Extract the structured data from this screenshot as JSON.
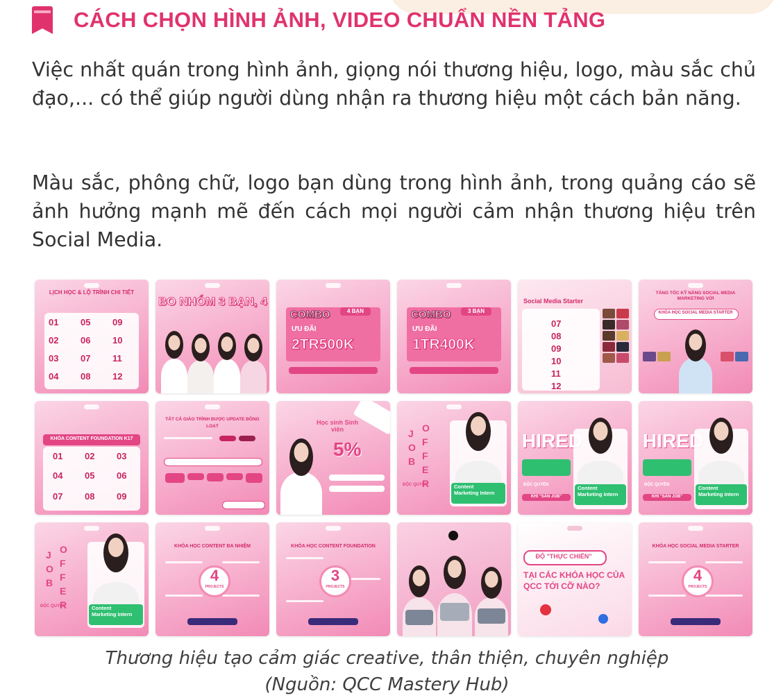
{
  "heading": {
    "title": "CÁCH CHỌN HÌNH ẢNH, VIDEO CHUẨN NỀN TẢNG",
    "icon": "bookmark-icon",
    "color": "#e0336e"
  },
  "paragraphs": [
    "Việc nhất quán trong hình ảnh, giọng nói thương hiệu, logo, màu sắc chủ đạo,... có thể giúp người dùng nhận ra thương hiệu một cách bản năng.",
    "Màu sắc, phông chữ, logo bạn dùng trong hình ảnh, trong quảng cáo sẽ ảnh hưởng mạnh mẽ đến cách mọi người cảm nhận thương hiệu trên Social Media."
  ],
  "gallery": {
    "accent_color": "#e34684",
    "tiles": [
      {
        "heading": "LỊCH HỌC & LỘ TRÌNH CHI TIẾT",
        "numbers": [
          "01",
          "05",
          "09",
          "02",
          "06",
          "10",
          "03",
          "07",
          "11",
          "04",
          "08",
          "12"
        ]
      },
      {
        "big": "BO NHÓM 3 BẠN, 4"
      },
      {
        "label": "COMBO",
        "tag": "4 BẠN",
        "sub": "ƯU ĐÃI",
        "price": "2TR500K"
      },
      {
        "label": "COMBO",
        "tag": "3 BẠN",
        "sub": "ƯU ĐÃI",
        "price": "1TR400K"
      },
      {
        "heading": "Social Media Starter",
        "numbers": [
          "07",
          "08",
          "09",
          "10",
          "11",
          "12"
        ]
      },
      {
        "heading": "TĂNG TỐC KỸ NĂNG SOCIAL MEDIA MARKETING VỚI",
        "sub": "KHÓA HỌC SOCIAL MEDIA STARTER"
      },
      {
        "heading": "KHÓA CONTENT FOUNDATION K17",
        "numbers": [
          "01",
          "02",
          "03",
          "04",
          "05",
          "06",
          "07",
          "08",
          "09"
        ]
      },
      {
        "heading": "TẤT CẢ GIÁO TRÌNH ĐƯỢC UPDATE ĐỒNG LOẠT"
      },
      {
        "heading": "Học sinh Sinh viên",
        "percent": "5%"
      },
      {
        "vertical": [
          "J",
          "O",
          "B",
          "O",
          "F",
          "F",
          "E",
          "R"
        ],
        "card": "Content Marketing Intern",
        "note": "ĐỘC QUYỀN"
      },
      {
        "big": "HIRED",
        "card": "Content Marketing Intern",
        "note": "ĐỘC QUYỀN",
        "sub": "KHI \"SĂN JOB\""
      },
      {
        "big": "HIRED",
        "card": "Content Marketing Intern",
        "note": "ĐỘC QUYỀN",
        "sub": "KHI \"SĂN JOB\""
      },
      {
        "vertical": [
          "J",
          "O",
          "B",
          "O",
          "F",
          "F",
          "E",
          "R"
        ],
        "card": "Content Marketing Intern",
        "note": "ĐỘC QUYỀN"
      },
      {
        "heading": "KHÓA HỌC CONTENT ĐA NHIỆM",
        "count": "4",
        "count_label": "PROJECTS"
      },
      {
        "heading": "KHÓA HỌC CONTENT FOUNDATION",
        "count": "3",
        "count_label": "PROJECTS"
      },
      {
        "people": 3
      },
      {
        "heading": "ĐỘ \"THỰC CHIẾN\"",
        "sub": "TẠI CÁC KHÓA HỌC CỦA QCC TỚI CỠ NÀO?"
      },
      {
        "heading": "KHÓA HỌC SOCIAL MEDIA STARTER",
        "count": "4",
        "count_label": "PROJECTS"
      }
    ]
  },
  "caption": {
    "line1": "Thương hiệu tạo cảm giác creative, thân thiện, chuyên nghiệp",
    "line2": "(Nguồn: QCC Mastery Hub)"
  }
}
